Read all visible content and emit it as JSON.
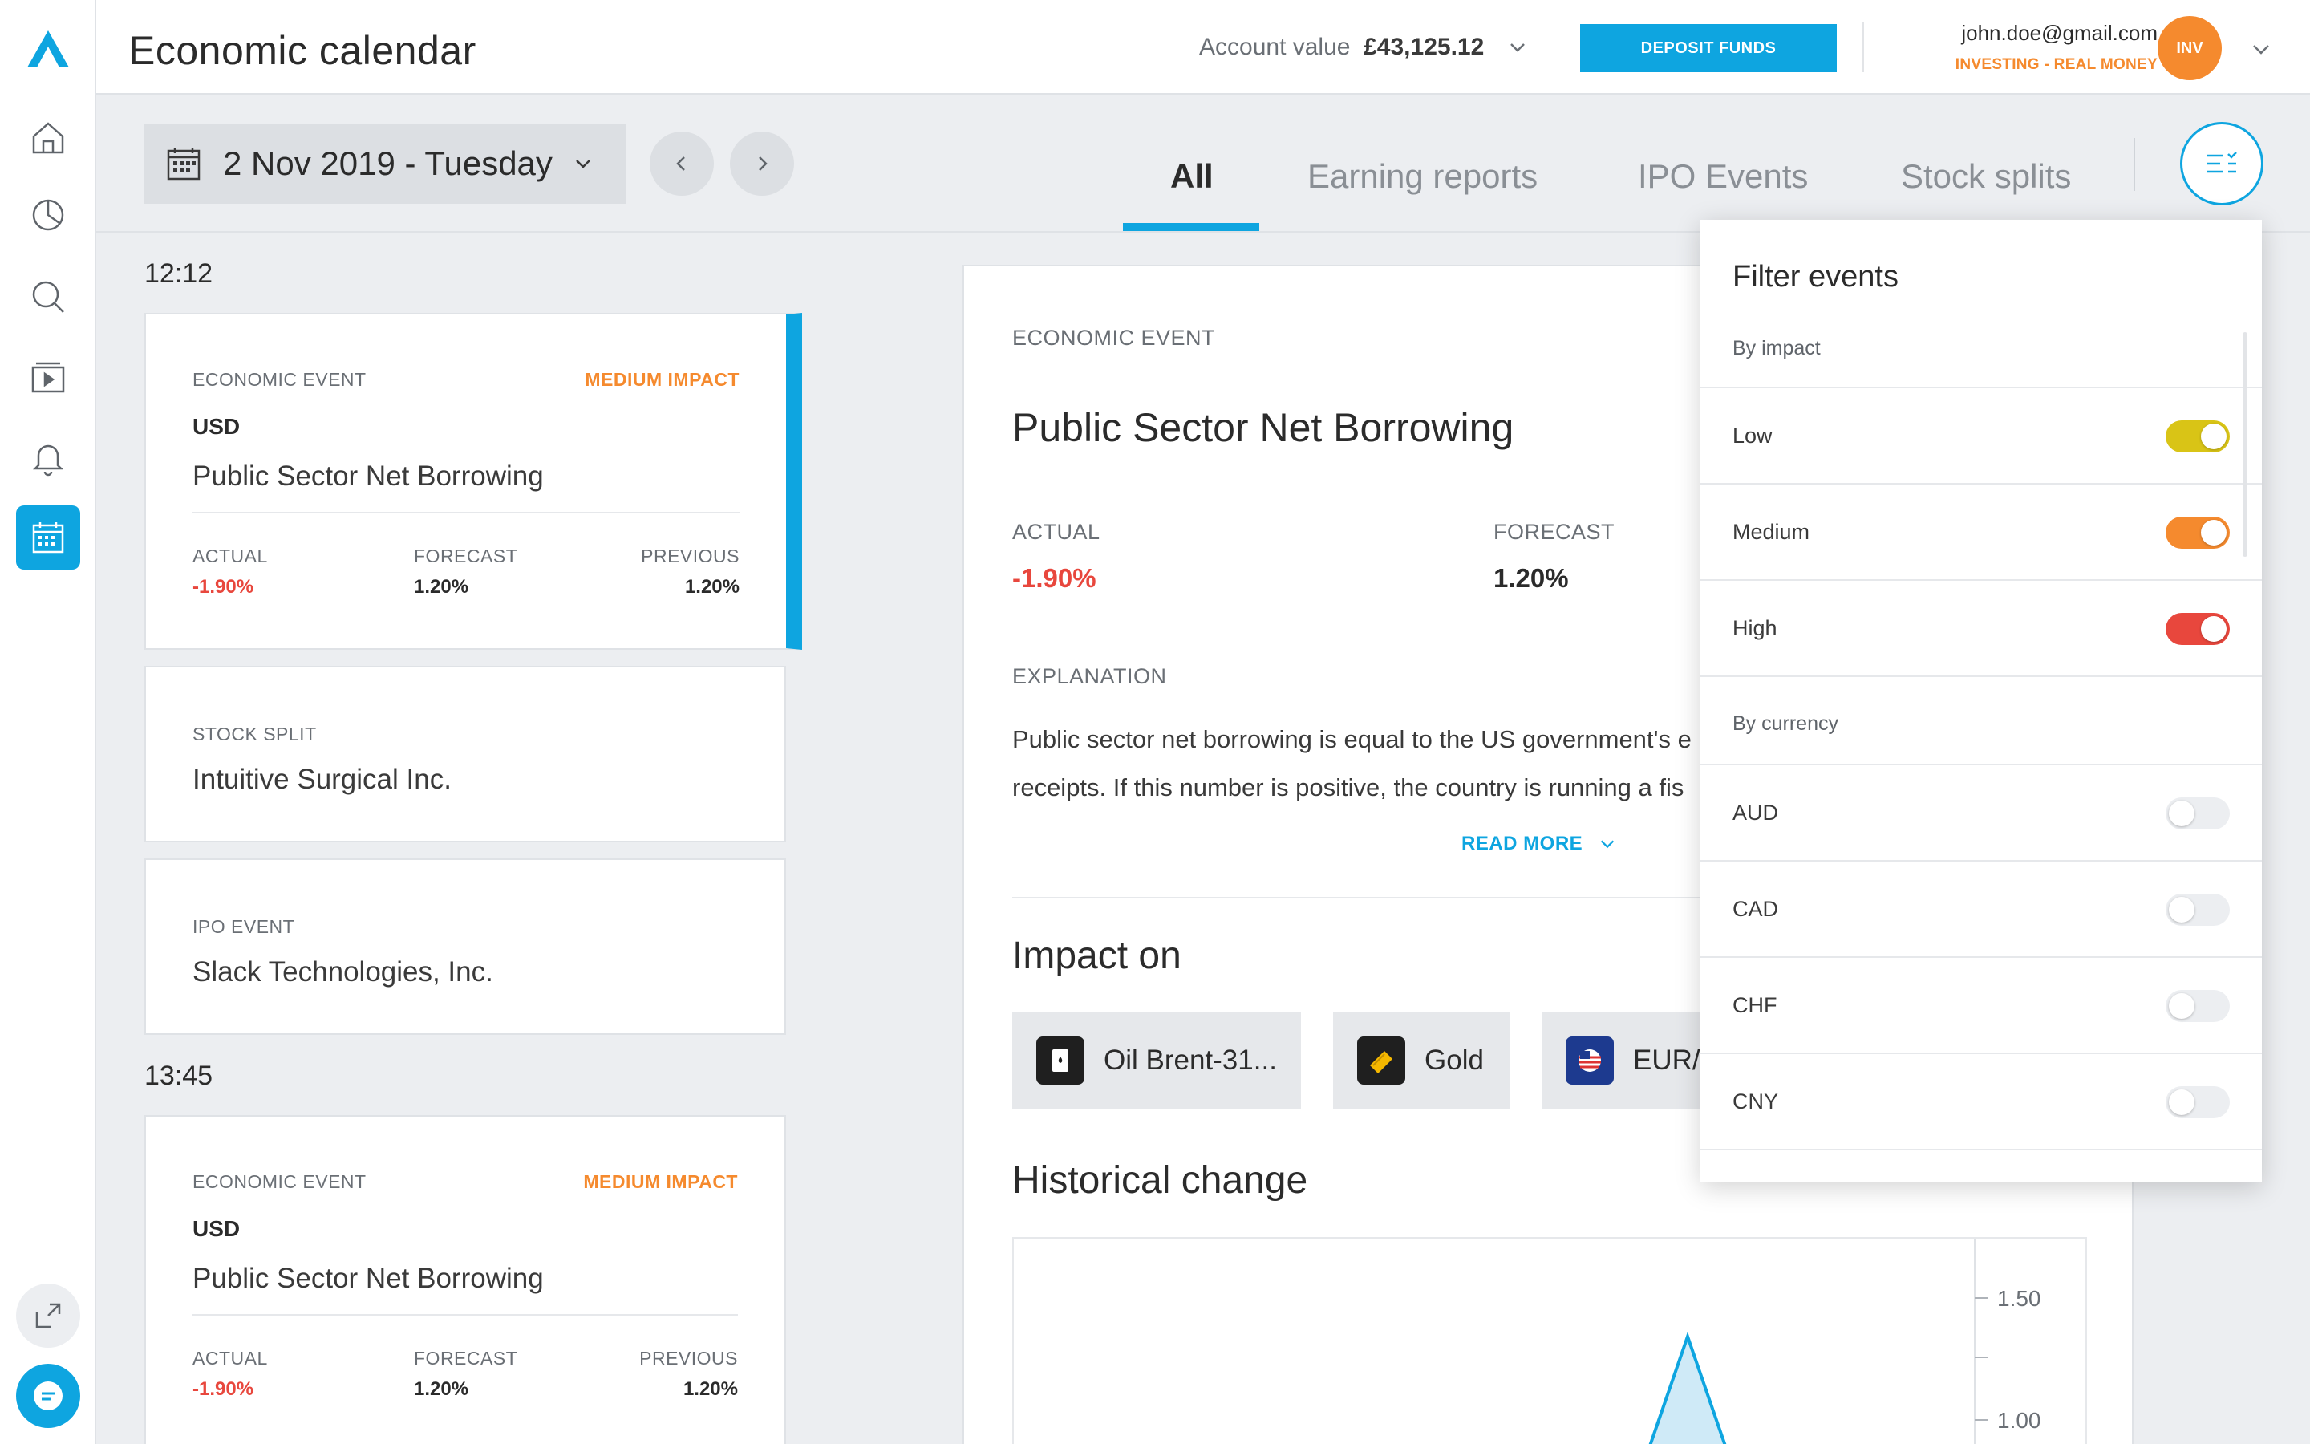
{
  "header": {
    "title": "Economic calendar",
    "account_label": "Account value",
    "account_value": "£43,125.12",
    "deposit_label": "DEPOSIT FUNDS",
    "user_email": "john.doe@gmail.com",
    "user_role": "INVESTING - REAL MONEY",
    "avatar_initials": "INV"
  },
  "toolbar": {
    "date": "2 Nov 2019 - Tuesday",
    "tabs": [
      {
        "label": "All",
        "active": true
      },
      {
        "label": "Earning reports",
        "active": false
      },
      {
        "label": "IPO Events",
        "active": false
      },
      {
        "label": "Stock splits",
        "active": false
      }
    ]
  },
  "sidebar": {
    "items": [
      "logo-icon",
      "home-icon",
      "portfolio-icon",
      "search-icon",
      "media-icon",
      "notifications-icon",
      "calendar-icon"
    ],
    "active": "calendar-icon",
    "accent": "#0ea5e0"
  },
  "events": {
    "groups": [
      {
        "time": "12:12",
        "cards": [
          {
            "type": "ECONOMIC EVENT",
            "impact": "MEDIUM IMPACT",
            "currency": "USD",
            "name": "Public Sector Net Borrowing",
            "actual_label": "ACTUAL",
            "actual": "-1.90%",
            "forecast_label": "FORECAST",
            "forecast": "1.20%",
            "previous_label": "PREVIOUS",
            "previous": "1.20%"
          },
          {
            "type": "STOCK SPLIT",
            "name": "Intuitive Surgical Inc."
          },
          {
            "type": "IPO EVENT",
            "name": "Slack Technologies, Inc."
          }
        ]
      },
      {
        "time": "13:45",
        "cards": [
          {
            "type": "ECONOMIC EVENT",
            "impact": "MEDIUM IMPACT",
            "currency": "USD",
            "name": "Public Sector Net Borrowing",
            "actual_label": "ACTUAL",
            "actual": "-1.90%",
            "forecast_label": "FORECAST",
            "forecast": "1.20%",
            "previous_label": "PREVIOUS",
            "previous": "1.20%"
          }
        ]
      }
    ]
  },
  "detail": {
    "section": "ECONOMIC EVENT",
    "title": "Public Sector Net Borrowing",
    "actual_label": "ACTUAL",
    "actual": "-1.90%",
    "forecast_label": "FORECAST",
    "forecast": "1.20%",
    "explanation_label": "EXPLANATION",
    "explanation_line1": "Public sector net borrowing is equal to the US government's e",
    "explanation_line2": "receipts. If this number is positive, the country is running a fis",
    "read_more": "READ MORE",
    "impact_title": "Impact on",
    "impact_items": [
      {
        "label": "Oil Brent-31...",
        "icon": "oil-barrel-icon"
      },
      {
        "label": "Gold",
        "icon": "gold-bar-icon"
      },
      {
        "label": "EUR/U",
        "icon": "eur-usd-flag-icon"
      }
    ],
    "historical_title": "Historical change",
    "chart_data": {
      "type": "area",
      "y_ticks": [
        "1.50",
        "1.00"
      ],
      "color": "#0ea5e0"
    }
  },
  "filter": {
    "title": "Filter events",
    "impact_group": "By impact",
    "impact_items": [
      {
        "label": "Low",
        "on": true,
        "color": "#d9c416"
      },
      {
        "label": "Medium",
        "on": true,
        "color": "#f58a2e"
      },
      {
        "label": "High",
        "on": true,
        "color": "#e8473d"
      }
    ],
    "currency_group": "By currency",
    "currency_items": [
      {
        "label": "AUD",
        "on": false
      },
      {
        "label": "CAD",
        "on": false
      },
      {
        "label": "CHF",
        "on": false
      },
      {
        "label": "CNY",
        "on": false
      }
    ]
  }
}
